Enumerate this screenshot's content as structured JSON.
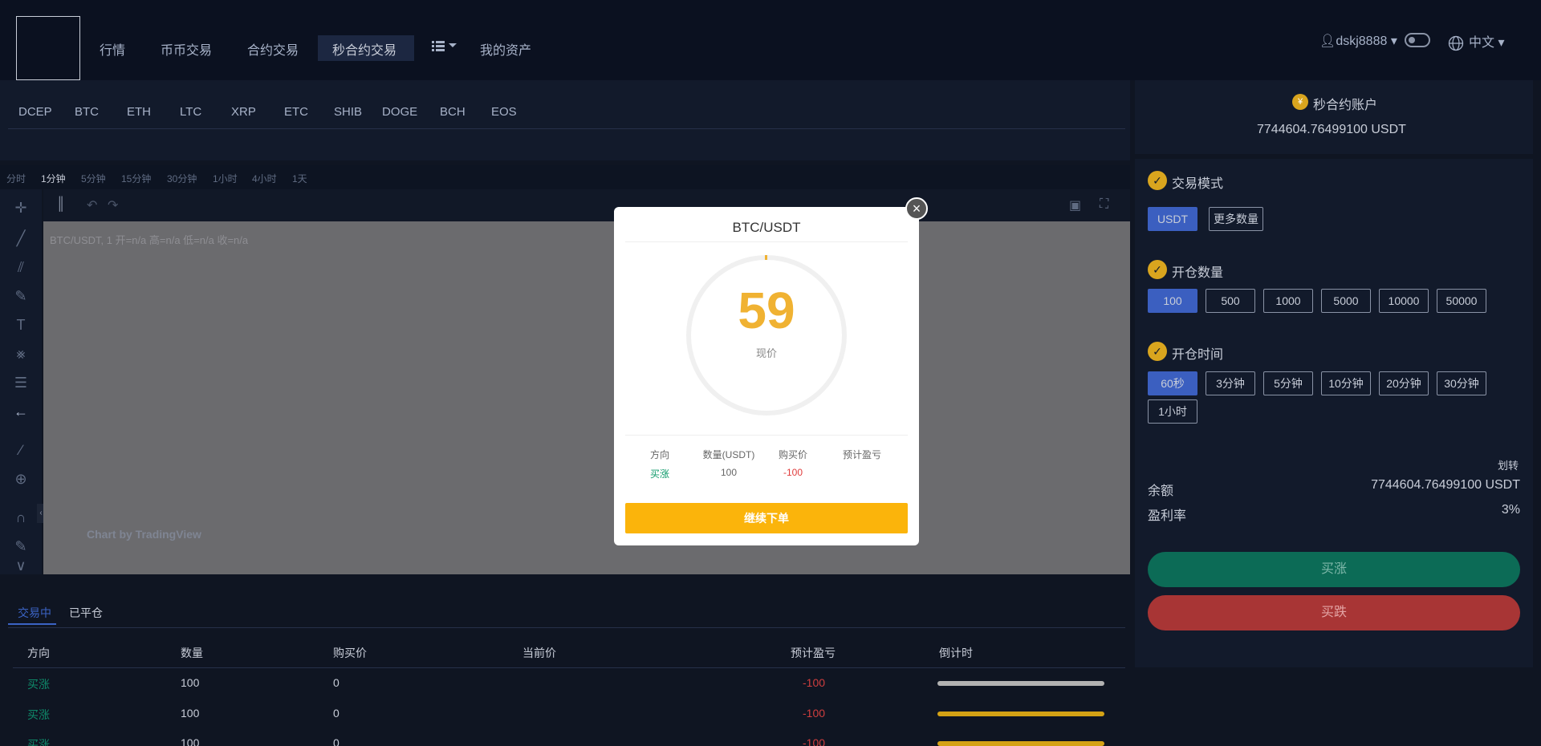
{
  "nav": {
    "items": [
      "行情",
      "币币交易",
      "合约交易",
      "秒合约交易",
      "我的资产"
    ],
    "username": "dskj8888",
    "language": "中文"
  },
  "coins": [
    "DCEP",
    "BTC",
    "ETH",
    "LTC",
    "XRP",
    "ETC",
    "SHIB",
    "DOGE",
    "BCH",
    "EOS"
  ],
  "chart": {
    "timeframes": [
      "分时",
      "1分钟",
      "5分钟",
      "15分钟",
      "30分钟",
      "1小时",
      "4小时",
      "1天"
    ],
    "active_timeframe": "1分钟",
    "ohlc_line": "BTC/USDT, 1   开=n/a  高=n/a  低=n/a  收=n/a",
    "watermark": "Chart by TradingView"
  },
  "orders": {
    "tabs": [
      "交易中",
      "已平仓"
    ],
    "headers": [
      "方向",
      "数量",
      "购买价",
      "当前价",
      "预计盈亏",
      "倒计时"
    ],
    "rows": [
      {
        "direction": "买涨",
        "qty": "100",
        "buy_price": "0",
        "pnl": "-100",
        "progress": 1.0
      },
      {
        "direction": "买涨",
        "qty": "100",
        "buy_price": "0",
        "pnl": "-100",
        "progress": 1.0
      },
      {
        "direction": "买涨",
        "qty": "100",
        "buy_price": "0",
        "pnl": "-100",
        "progress": 1.0
      }
    ]
  },
  "account": {
    "title": "秒合约账户",
    "balance": "7744604.76499100 USDT"
  },
  "trade": {
    "mode_title": "交易模式",
    "mode_options": [
      "USDT",
      "更多数量"
    ],
    "qty_title": "开仓数量",
    "qty_options": [
      "100",
      "500",
      "1000",
      "5000",
      "10000",
      "50000"
    ],
    "time_title": "开仓时间",
    "time_options": [
      "60秒",
      "3分钟",
      "5分钟",
      "10分钟",
      "20分钟",
      "30分钟",
      "1小时"
    ],
    "transfer": "划转",
    "balance_label": "余额",
    "balance_value": "7744604.76499100 USDT",
    "rate_label": "盈利率",
    "rate_value": "3%",
    "buy_up": "买涨",
    "buy_down": "买跌"
  },
  "modal": {
    "title": "BTC/USDT",
    "countdown": "59",
    "countdown_label": "现价",
    "headers": [
      "方向",
      "数量(USDT)",
      "购买价",
      "预计盈亏"
    ],
    "direction": "买涨",
    "qty": "100",
    "pnl": "-100",
    "continue_label": "继续下单"
  },
  "colors": {
    "accent_blue": "#3b5fc0",
    "gold": "#f0b232",
    "green": "#0c6b56",
    "red": "#a83535"
  }
}
